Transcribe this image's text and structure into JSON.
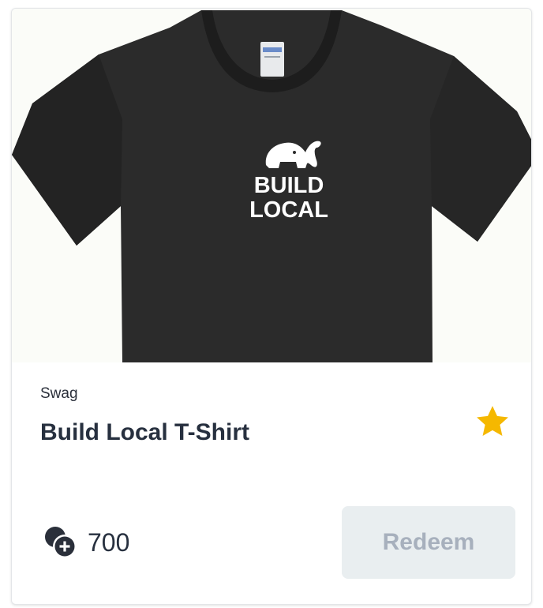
{
  "product": {
    "image_alt": "Black t-shirt with Build Local elephant logo",
    "logo_line1": "BUILD",
    "logo_line2": "LOCAL",
    "category": "Swag",
    "title": "Build Local T-Shirt",
    "favorite_icon": "star-icon",
    "points_icon": "points-icon",
    "points": "700",
    "redeem_label": "Redeem",
    "redeem_enabled": false
  },
  "colors": {
    "star": "#f5b800",
    "shirt": "#2b2b2b",
    "button_bg": "#e9eef0",
    "button_text": "#a7b0bd",
    "title_text": "#27303f"
  }
}
